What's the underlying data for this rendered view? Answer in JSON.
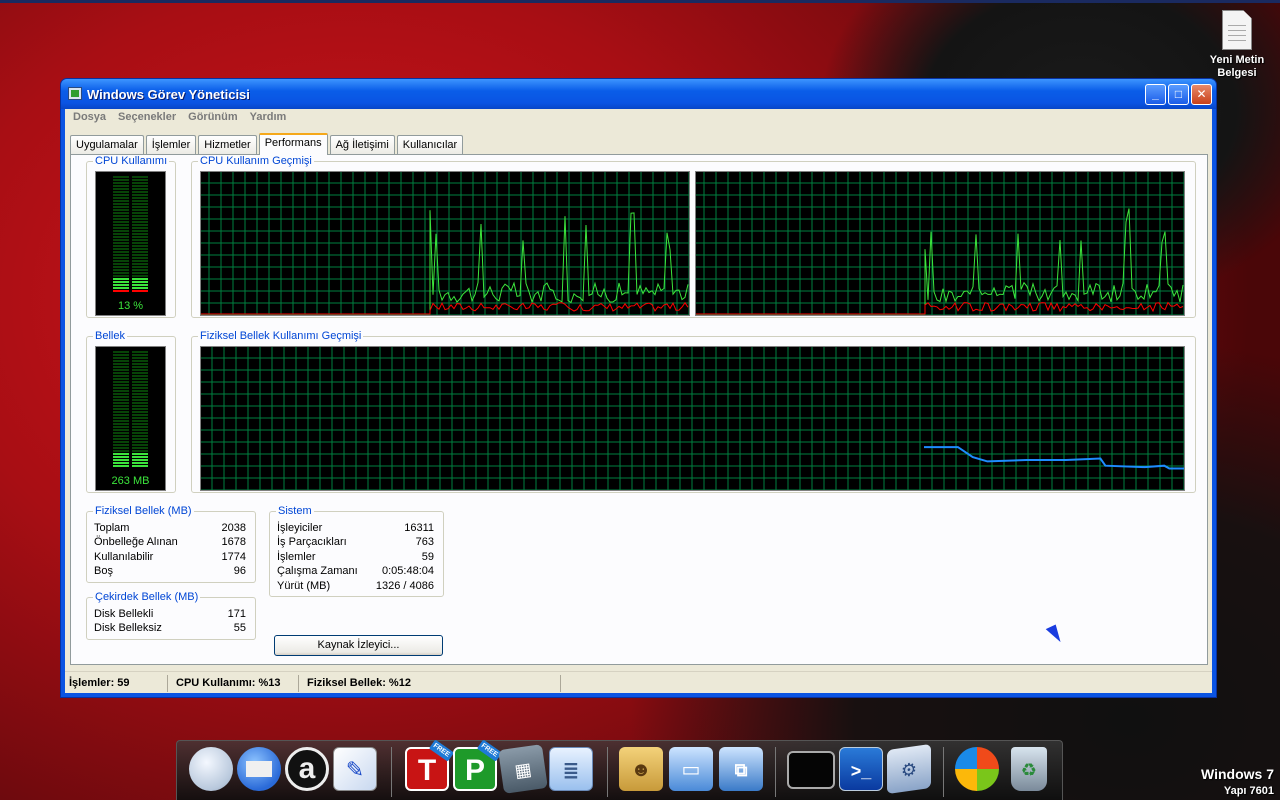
{
  "desktop": {
    "icon_label": "Yeni Metin Belgesi",
    "watermark_line1": "Windows 7",
    "watermark_line2": "Yapı 7601"
  },
  "window": {
    "title": "Windows Görev Yöneticisi",
    "menu": [
      "Dosya",
      "Seçenekler",
      "Görünüm",
      "Yardım"
    ],
    "tabs": [
      "Uygulamalar",
      "İşlemler",
      "Hizmetler",
      "Performans",
      "Ağ İletişimi",
      "Kullanıcılar"
    ],
    "active_tab": "Performans",
    "colors": {
      "title_blue": "#0a54e3",
      "meter_green": "#3ce53c",
      "grid_green": "#008040",
      "cpu_red": "#ff0000",
      "mem_blue": "#1e8cff"
    }
  },
  "performance": {
    "cpu_usage": {
      "label": "CPU Kullanımı",
      "value_text": "13 %",
      "level": 0.13
    },
    "cpu_history": {
      "label": "CPU Kullanım Geçmişi"
    },
    "memory": {
      "label": "Bellek",
      "value_text": "263 MB",
      "level": 0.13
    },
    "memory_history": {
      "label": "Fiziksel Bellek Kullanımı Geçmişi"
    },
    "physical_memory": {
      "label": "Fiziksel Bellek (MB)",
      "rows": [
        {
          "name": "Toplam",
          "value": "2038"
        },
        {
          "name": "Önbelleğe Alınan",
          "value": "1678"
        },
        {
          "name": "Kullanılabilir",
          "value": "1774"
        },
        {
          "name": "Boş",
          "value": "96"
        }
      ]
    },
    "kernel_memory": {
      "label": "Çekirdek Bellek (MB)",
      "rows": [
        {
          "name": "Disk Bellekli",
          "value": "171"
        },
        {
          "name": "Disk Belleksiz",
          "value": "55"
        }
      ]
    },
    "system": {
      "label": "Sistem",
      "rows": [
        {
          "name": "İşleyiciler",
          "value": "16311"
        },
        {
          "name": "İş Parçacıkları",
          "value": "763"
        },
        {
          "name": "İşlemler",
          "value": "59"
        },
        {
          "name": "Çalışma Zamanı",
          "value": "0:05:48:04"
        },
        {
          "name": "Yürüt (MB)",
          "value": "1326 / 4086"
        }
      ]
    },
    "resource_monitor_button": "Kaynak İzleyici..."
  },
  "statusbar": {
    "processes": "İşlemler: 59",
    "cpu": "CPU Kullanımı: %13",
    "memory": "Fiziksel Bellek: %12"
  },
  "dock": {
    "items": [
      "globe-icon",
      "mail-icon",
      "a-icon",
      "paint-icon",
      "T-free-icon",
      "P-free-icon",
      "calculator-icon",
      "notepad-icon",
      "user-folder-icon",
      "computer-icon",
      "network-icon",
      "cmd-icon",
      "powershell-icon",
      "control-panel-icon",
      "windows-update-icon",
      "recycle-bin-icon"
    ],
    "t_letter": "T",
    "p_letter": "P",
    "a_letter": "a",
    "free_badge": "FREE"
  }
}
